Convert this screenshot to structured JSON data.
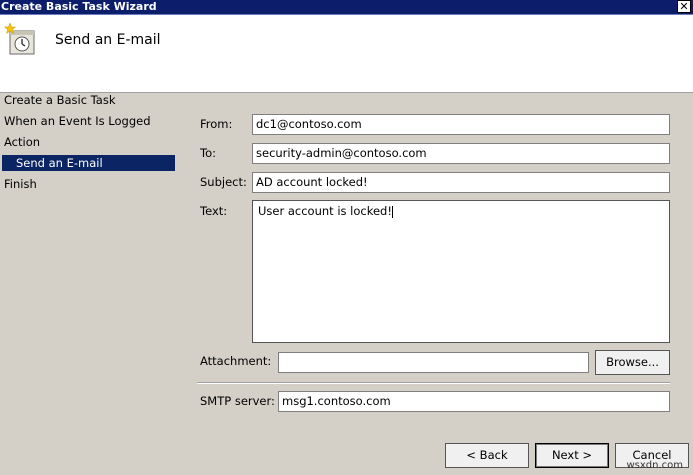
{
  "window": {
    "title": "Create Basic Task Wizard",
    "close_glyph": "✕"
  },
  "header": {
    "title": "Send an E-mail",
    "icon": "task-clock-icon"
  },
  "steps": [
    {
      "label": "Create a Basic Task"
    },
    {
      "label": "When an Event Is Logged"
    },
    {
      "label": "Action"
    },
    {
      "label": "Send an E-mail",
      "selected": true
    },
    {
      "label": "Finish"
    }
  ],
  "form": {
    "from_label": "From:",
    "from_value": "dc1@contoso.com",
    "to_label": "To:",
    "to_value": "security-admin@contoso.com",
    "subject_label": "Subject:",
    "subject_value": "AD account locked!",
    "text_label": "Text:",
    "text_value": "User account is locked!",
    "attachment_label": "Attachment:",
    "attachment_value": "",
    "browse_label": "Browse...",
    "smtp_label": "SMTP server:",
    "smtp_value": "msg1.contoso.com"
  },
  "footer": {
    "back_label": "< Back",
    "next_label": "Next >",
    "cancel_label": "Cancel"
  },
  "watermark": "wsxdn.com",
  "colors": {
    "titlebar": "#0b1d6b",
    "selection": "#0b2464",
    "dialog_bg": "#d4d0c8"
  }
}
